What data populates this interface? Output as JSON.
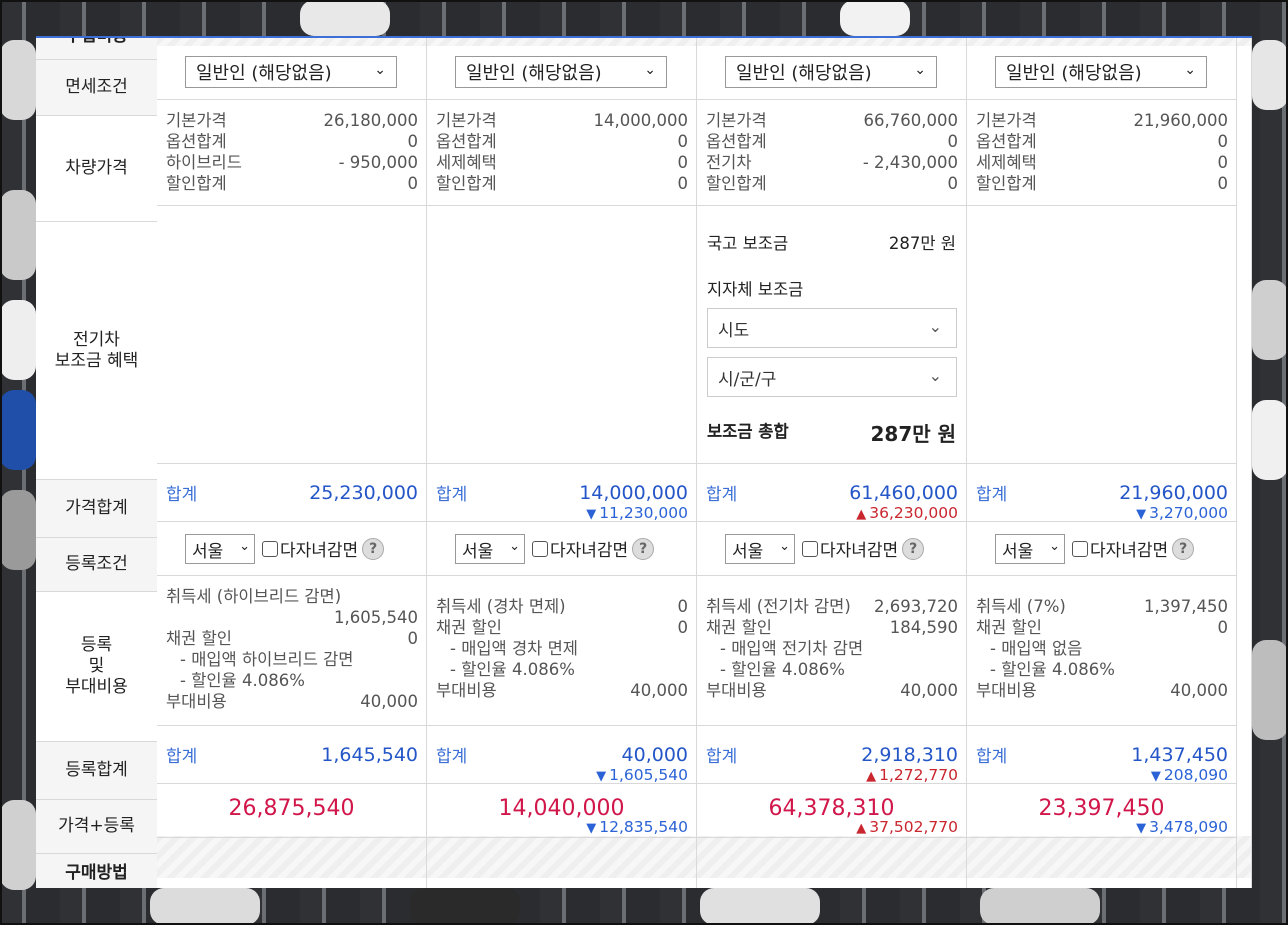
{
  "left_labels": {
    "top_cut": "구입비용",
    "tax_condition": "면세조건",
    "car_price": "차량가격",
    "ev_subsidy_line1": "전기차",
    "ev_subsidy_line2": "보조금 혜택",
    "price_total": "가격합계",
    "reg_condition": "등록조건",
    "reg_line1": "등록",
    "reg_line2": "및",
    "reg_line3": "부대비용",
    "reg_total": "등록합계",
    "price_plus_reg": "가격+등록",
    "purchase_method": "구매방법"
  },
  "sum_label": "합계",
  "cols": [
    {
      "tax_select": "일반인 (해당없음)",
      "prices": [
        {
          "k": "기본가격",
          "v": "26,180,000"
        },
        {
          "k": "옵션합계",
          "v": "0"
        },
        {
          "k": "하이브리드",
          "v": "- 950,000"
        },
        {
          "k": "할인합계",
          "v": "0"
        }
      ],
      "price_sum": "25,230,000",
      "price_diff": "",
      "region": "서울",
      "multi_child": "다자녀감면",
      "tax_title": "취득세 (하이브리드 감면)",
      "tax_value": "1,605,540",
      "bond": "채권 할인",
      "bond_value": "0",
      "bond_sub1": "- 매입액 하이브리드 감면",
      "bond_sub2": "- 할인율 4.086%",
      "extra": "부대비용",
      "extra_value": "40,000",
      "reg_sum": "1,645,540",
      "reg_diff": "",
      "total": "26,875,540",
      "total_diff": ""
    },
    {
      "tax_select": "일반인 (해당없음)",
      "prices": [
        {
          "k": "기본가격",
          "v": "14,000,000"
        },
        {
          "k": "옵션합계",
          "v": "0"
        },
        {
          "k": "세제혜택",
          "v": "0"
        },
        {
          "k": "할인합계",
          "v": "0"
        }
      ],
      "price_sum": "14,000,000",
      "price_diff": "11,230,000",
      "region": "서울",
      "multi_child": "다자녀감면",
      "tax_title": "취득세 (경차 면제)",
      "tax_value": "0",
      "bond": "채권 할인",
      "bond_value": "0",
      "bond_sub1": "- 매입액 경차 면제",
      "bond_sub2": "- 할인율 4.086%",
      "extra": "부대비용",
      "extra_value": "40,000",
      "reg_sum": "40,000",
      "reg_diff": "1,605,540",
      "total": "14,040,000",
      "total_diff": "12,835,540"
    },
    {
      "tax_select": "일반인 (해당없음)",
      "prices": [
        {
          "k": "기본가격",
          "v": "66,760,000"
        },
        {
          "k": "옵션합계",
          "v": "0"
        },
        {
          "k": "전기차",
          "v": "- 2,430,000"
        },
        {
          "k": "할인합계",
          "v": "0"
        }
      ],
      "subsidy": {
        "national_label": "국고 보조금",
        "national_value": "287만 원",
        "local_label": "지자체 보조금",
        "sido": "시도",
        "sigungu": "시/군/구",
        "total_label": "보조금 총합",
        "total_value": "287만 원"
      },
      "price_sum": "61,460,000",
      "price_diff": "36,230,000",
      "region": "서울",
      "multi_child": "다자녀감면",
      "tax_title": "취득세 (전기차 감면)",
      "tax_value": "2,693,720",
      "bond": "채권 할인",
      "bond_value": "184,590",
      "bond_sub1": "- 매입액 전기차 감면",
      "bond_sub2": "- 할인율 4.086%",
      "extra": "부대비용",
      "extra_value": "40,000",
      "reg_sum": "2,918,310",
      "reg_diff": "1,272,770",
      "total": "64,378,310",
      "total_diff": "37,502,770"
    },
    {
      "tax_select": "일반인 (해당없음)",
      "prices": [
        {
          "k": "기본가격",
          "v": "21,960,000"
        },
        {
          "k": "옵션합계",
          "v": "0"
        },
        {
          "k": "세제혜택",
          "v": "0"
        },
        {
          "k": "할인합계",
          "v": "0"
        }
      ],
      "price_sum": "21,960,000",
      "price_diff": "3,270,000",
      "region": "서울",
      "multi_child": "다자녀감면",
      "tax_title": "취득세 (7%)",
      "tax_value": "1,397,450",
      "bond": "채권 할인",
      "bond_value": "0",
      "bond_sub1": "- 매입액 없음",
      "bond_sub2": "- 할인율 4.086%",
      "extra": "부대비용",
      "extra_value": "40,000",
      "reg_sum": "1,437,450",
      "reg_diff": "208,090",
      "total": "23,397,450",
      "total_diff": "3,478,090"
    }
  ],
  "icons": {
    "chevron": "chevron-down-icon",
    "help": "help-circle-icon",
    "triangle_down": "triangle-down-icon",
    "triangle_up": "triangle-up-icon"
  },
  "colors": {
    "accent_blue": "#2456c8",
    "total_red": "#d1164a",
    "increase_red": "#c9262e",
    "decrease_blue": "#2b63d6"
  }
}
